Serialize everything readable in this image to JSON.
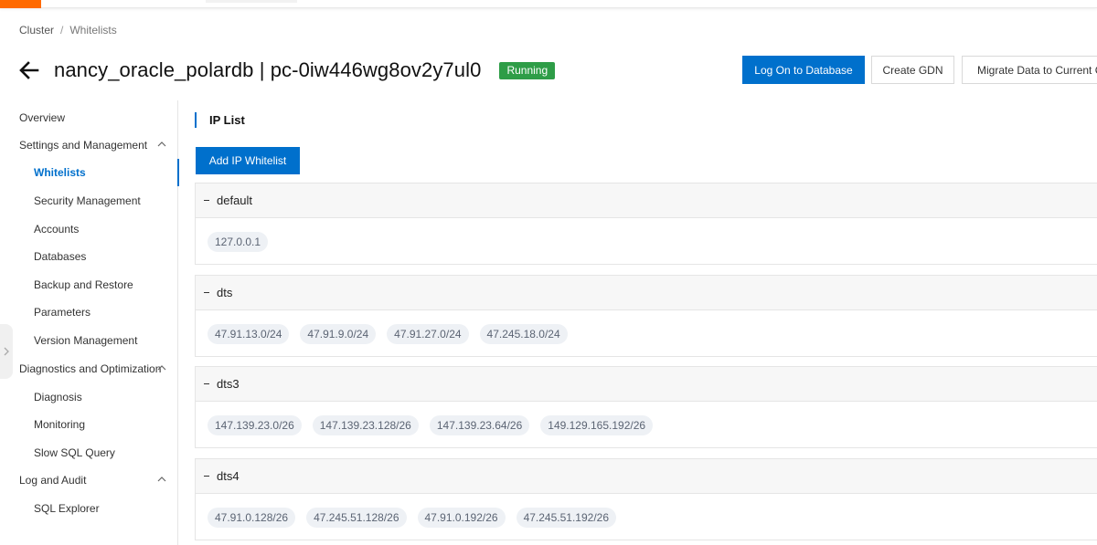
{
  "breadcrumb": {
    "items": [
      "Cluster",
      "Whitelists"
    ],
    "separator": "/"
  },
  "header": {
    "title": "nancy_oracle_polardb | pc-0iw446wg8ov2y7ul0",
    "status": "Running"
  },
  "actions": {
    "logon": "Log On to Database",
    "gdn": "Create GDN",
    "migrate": "Migrate Data to Current C"
  },
  "sidebar": {
    "overview": "Overview",
    "settings": "Settings and Management",
    "whitelists": "Whitelists",
    "security": "Security Management",
    "accounts": "Accounts",
    "databases": "Databases",
    "backup": "Backup and Restore",
    "parameters": "Parameters",
    "version": "Version Management",
    "diagnostics": "Diagnostics and Optimization",
    "diagnosis": "Diagnosis",
    "monitoring": "Monitoring",
    "slowsql": "Slow SQL Query",
    "logaudit": "Log and Audit",
    "sqlexplorer": "SQL Explorer"
  },
  "main": {
    "section_title": "IP List",
    "add_button": "Add IP Whitelist",
    "groups": [
      {
        "name": "default",
        "ips": [
          "127.0.0.1"
        ]
      },
      {
        "name": "dts",
        "ips": [
          "47.91.13.0/24",
          "47.91.9.0/24",
          "47.91.27.0/24",
          "47.245.18.0/24"
        ]
      },
      {
        "name": "dts3",
        "ips": [
          "147.139.23.0/26",
          "147.139.23.128/26",
          "147.139.23.64/26",
          "149.129.165.192/26"
        ]
      },
      {
        "name": "dts4",
        "ips": [
          "47.91.0.128/26",
          "47.245.51.128/26",
          "47.91.0.192/26",
          "47.245.51.192/26"
        ]
      }
    ]
  },
  "colors": {
    "brand": "#ff6a00",
    "primary": "#0070cc",
    "running": "#2e9d47"
  }
}
